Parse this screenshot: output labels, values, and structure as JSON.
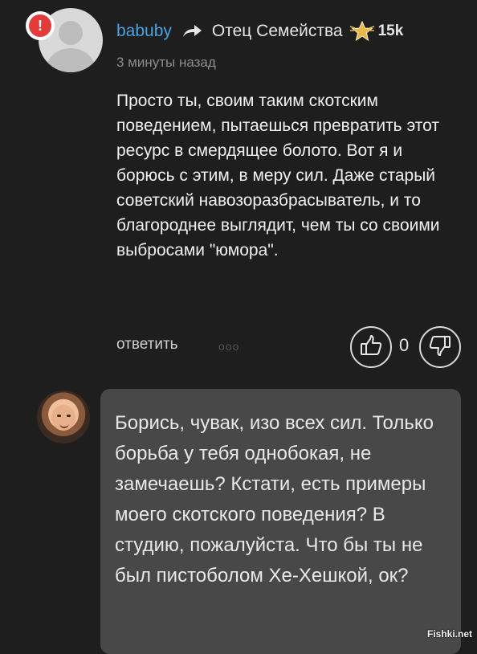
{
  "comment": {
    "alert_badge": "!",
    "username": "babuby",
    "recipient": "Отец Семейства",
    "points": "15k",
    "timestamp": "3 минуты назад",
    "text": "Просто ты, своим таким скотским поведением, пытаешься превратить этот ресурс в смердящее болото. Вот я и борюсь с этим, в меру сил. Даже старый советский навозоразбрасыватель, и то благороднее выглядит, чем ты со своими выбросами \"юмора\".",
    "reply_label": "ответить",
    "more_label": "ooo",
    "vote_count": "0",
    "icons": {
      "reply_arrow": "arrow-icon",
      "rank_star": "star-icon",
      "like": "thumbs-up-icon",
      "dislike": "thumbs-down-icon"
    }
  },
  "reply": {
    "text": "Борись, чувак, изо всех сил. Только борьба у тебя однобокая, не замечаешь? Кстати, есть примеры моего скотского поведения? В студию, пожалуйста. Что бы ты не был пистоболом Хе-Хешкой, ок?"
  },
  "watermark": "Fishki.net",
  "colors": {
    "background": "#1e1e1e",
    "username": "#4aa3e0",
    "alert": "#e33a3a",
    "bubble": "#484848",
    "star": "#e8b84a"
  }
}
